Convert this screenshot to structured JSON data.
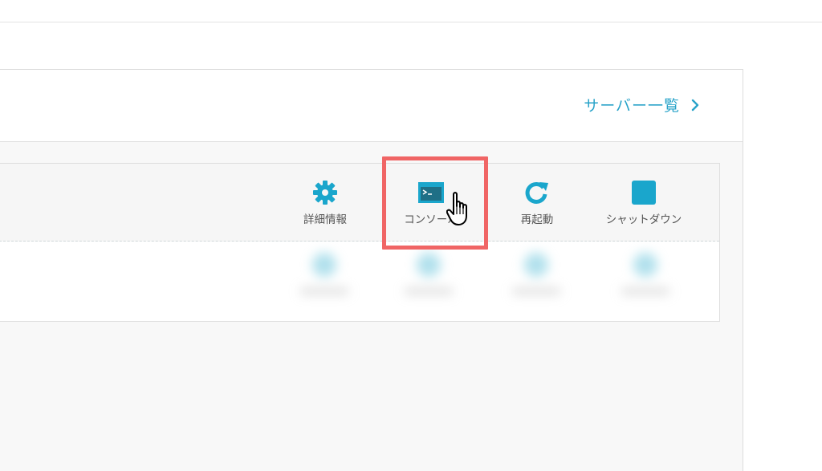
{
  "header": {
    "server_list_label": "サーバー一覧"
  },
  "toolbar": {
    "actions": [
      {
        "label": "詳細情報",
        "icon": "gear-icon"
      },
      {
        "label": "コンソール",
        "icon": "terminal-icon"
      },
      {
        "label": "再起動",
        "icon": "restart-icon"
      },
      {
        "label": "シャットダウン",
        "icon": "stop-square-icon"
      }
    ],
    "highlighted_action": "コンソール"
  },
  "colors": {
    "accent": "#29a3c9",
    "icon_teal": "#1aa6cc",
    "highlight": "#f06565",
    "label_text": "#555555"
  }
}
